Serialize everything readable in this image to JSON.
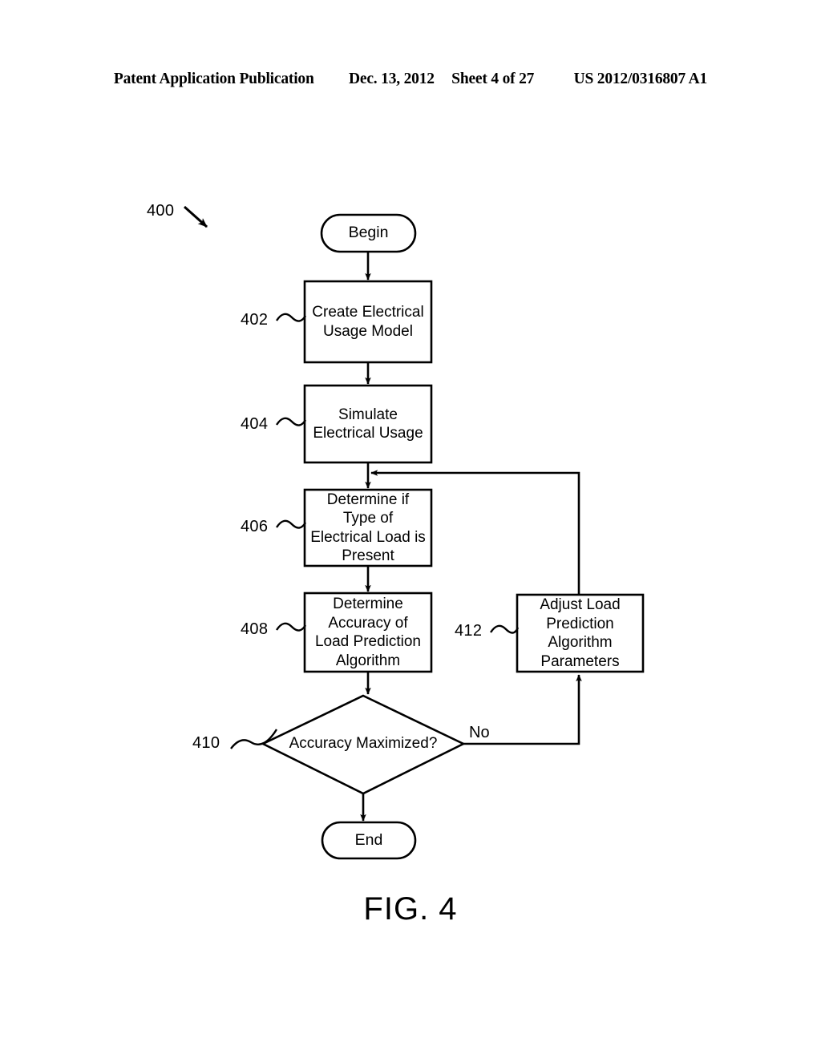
{
  "header": {
    "publication": "Patent Application Publication",
    "date": "Dec. 13, 2012",
    "sheet": "Sheet 4 of 27",
    "patent_number": "US 2012/0316807 A1"
  },
  "figure": {
    "caption": "FIG. 4",
    "diagram_ref": "400",
    "nodes": [
      {
        "id": "begin",
        "ref": "",
        "shape": "terminal",
        "label": "Begin"
      },
      {
        "id": "n402",
        "ref": "402",
        "shape": "process",
        "label": "Create Electrical\nUsage Model"
      },
      {
        "id": "n404",
        "ref": "404",
        "shape": "process",
        "label": "Simulate\nElectrical Usage"
      },
      {
        "id": "n406",
        "ref": "406",
        "shape": "process",
        "label": "Determine if\nType of\nElectrical Load is\nPresent"
      },
      {
        "id": "n408",
        "ref": "408",
        "shape": "process",
        "label": "Determine\nAccuracy of\nLoad Prediction\nAlgorithm"
      },
      {
        "id": "n410",
        "ref": "410",
        "shape": "decision",
        "label": "Accuracy Maximized?"
      },
      {
        "id": "n412",
        "ref": "412",
        "shape": "process",
        "label": "Adjust Load\nPrediction\nAlgorithm\nParameters"
      },
      {
        "id": "end",
        "ref": "",
        "shape": "terminal",
        "label": "End"
      }
    ],
    "edges": [
      {
        "from": "begin",
        "to": "n402",
        "label": ""
      },
      {
        "from": "n402",
        "to": "n404",
        "label": ""
      },
      {
        "from": "n404",
        "to": "n406",
        "label": ""
      },
      {
        "from": "n406",
        "to": "n408",
        "label": ""
      },
      {
        "from": "n408",
        "to": "n410",
        "label": ""
      },
      {
        "from": "n410",
        "to": "end",
        "label": ""
      },
      {
        "from": "n410",
        "to": "n412",
        "label": "No"
      },
      {
        "from": "n412",
        "to": "n406",
        "label": ""
      }
    ],
    "branch_labels": {
      "no": "No"
    },
    "colors": {
      "stroke": "#000000",
      "background": "#ffffff"
    }
  }
}
